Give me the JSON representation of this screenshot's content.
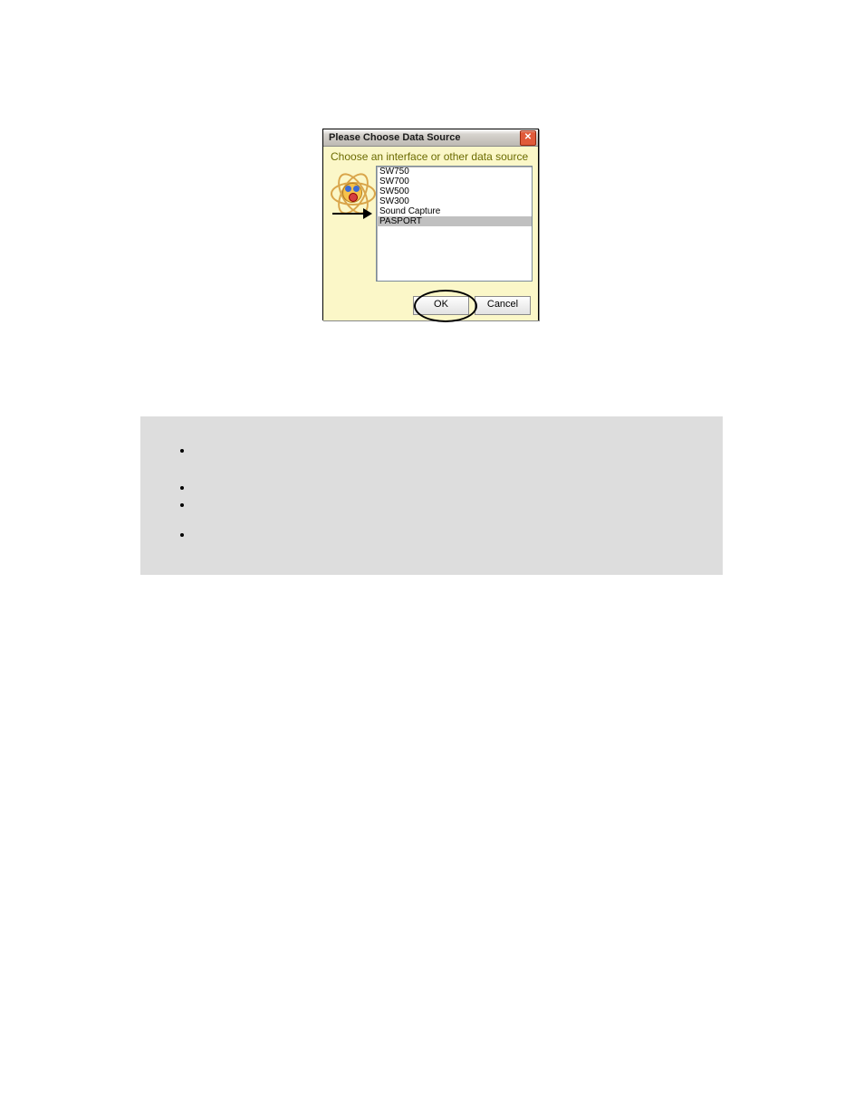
{
  "dialog": {
    "title": "Please Choose Data Source",
    "instruction": "Choose an interface or other data source",
    "list": {
      "items": [
        "SW750",
        "SW700",
        "SW500",
        "SW300",
        "Sound Capture",
        "PASPORT"
      ],
      "selected_index": 5
    },
    "buttons": {
      "ok": "OK",
      "cancel": "Cancel"
    },
    "close_glyph": "✕"
  },
  "panel": {
    "bullets": [
      "",
      "",
      "",
      ""
    ]
  }
}
